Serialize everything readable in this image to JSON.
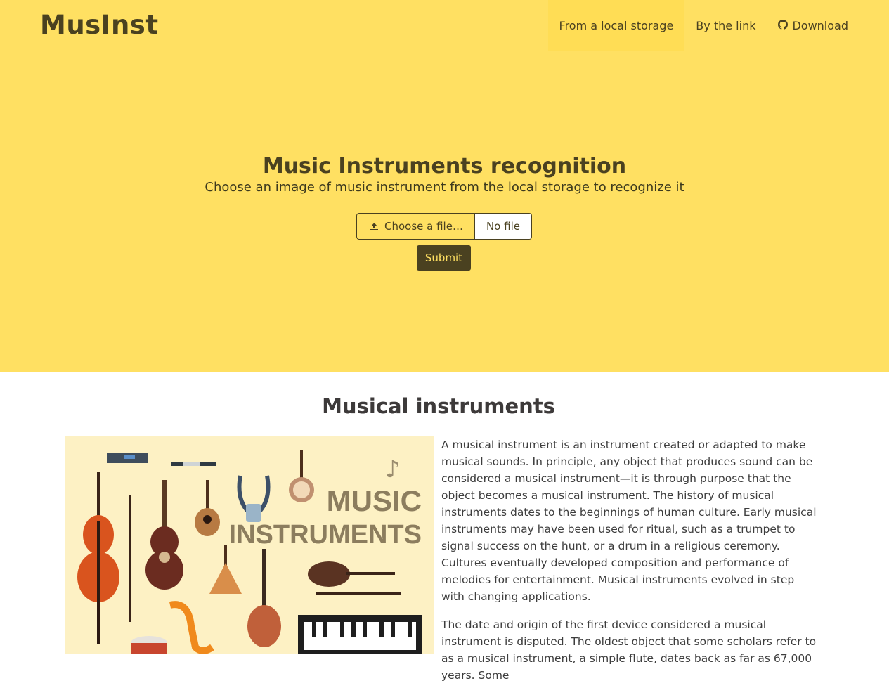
{
  "brand": "MusInst",
  "nav": {
    "items": [
      {
        "label": "From a local storage",
        "active": true
      },
      {
        "label": "By the link",
        "active": false
      },
      {
        "label": "Download",
        "icon": "github-icon"
      }
    ]
  },
  "hero": {
    "title": "Music Instruments recognition",
    "subtitle": "Choose an image of music instrument from the local storage to recognize it",
    "choose_label": "Choose a file…",
    "file_name": "No file",
    "submit_label": "Submit"
  },
  "section": {
    "title": "Musical instruments",
    "image_text_line1": "MUSIC",
    "image_text_line2": "INSTRUMENTS",
    "paragraphs": [
      "A musical instrument is an instrument created or adapted to make musical sounds. In principle, any object that produces sound can be considered a musical instrument—it is through purpose that the object becomes a musical instrument. The history of musical instruments dates to the beginnings of human culture. Early musical instruments may have been used for ritual, such as a trumpet to signal success on the hunt, or a drum in a religious ceremony. Cultures eventually developed composition and performance of melodies for entertainment. Musical instruments evolved in step with changing applications.",
      "The date and origin of the first device considered a musical instrument is disputed. The oldest object that some scholars refer to as a musical instrument, a simple flute, dates back as far as 67,000 years. Some"
    ]
  },
  "colors": {
    "hero_bg": "#ffe062",
    "dark": "#4a4120"
  }
}
